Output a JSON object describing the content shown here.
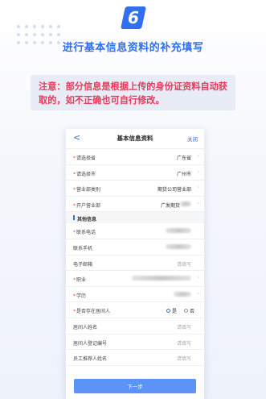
{
  "step_number": "6",
  "title": "进行基本信息资料的补充填写",
  "notice": "注意：部分信息是根据上传的身份证资料自动获取的，如不正确也可自行修改。",
  "colors": {
    "accent": "#2f6ff0",
    "notice_text": "#e83a5a",
    "notice_bg": "#e8ecf7",
    "button": "#5b93f6"
  },
  "phone": {
    "nav": {
      "back_icon": "chevron-left-icon",
      "back": "<",
      "title": "基本信息资料",
      "close": "关闭"
    },
    "fields_top": [
      {
        "label": "请选择省",
        "required": true,
        "value": "广东省"
      },
      {
        "label": "请选择市",
        "required": true,
        "value": "广州市"
      },
      {
        "label": "营业部类别",
        "required": true,
        "value": "期货公司营业部"
      },
      {
        "label": "开户营业部",
        "required": true,
        "value": "广发期货"
      }
    ],
    "section_label": "其他信息",
    "fields_other": [
      {
        "label": "联系电话",
        "required": true
      },
      {
        "label": "联系手机",
        "required": false
      },
      {
        "label": "电子邮箱",
        "required": false,
        "placeholder": "请填写"
      },
      {
        "label": "职业",
        "required": true
      },
      {
        "label": "学历",
        "required": true
      },
      {
        "label": "是否存在居间人",
        "required": true
      },
      {
        "label": "居间人姓名",
        "required": false,
        "placeholder": "请填写"
      },
      {
        "label": "居间人登记编号",
        "required": false,
        "placeholder": "请填写"
      },
      {
        "label": "员工推荐人姓名",
        "required": false,
        "placeholder": "请填写"
      }
    ],
    "radio": {
      "yes": "是",
      "no": "否",
      "selected": "yes"
    },
    "next_button": "下一步"
  }
}
